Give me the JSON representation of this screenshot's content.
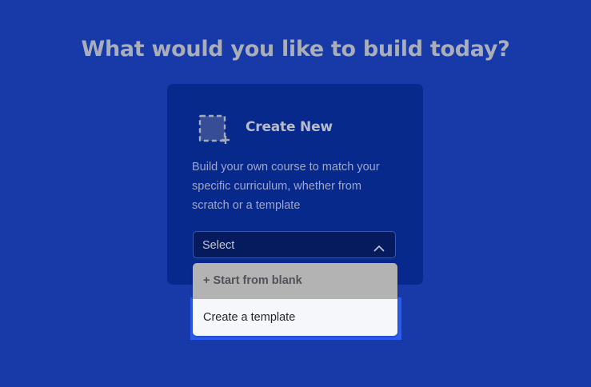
{
  "page": {
    "headline": "What would you like to build today?"
  },
  "card": {
    "icon": "dashed-square-plus-icon",
    "title": "Create New",
    "description": "Build your own course to match your specific curriculum, whether from scratch or a template"
  },
  "select": {
    "value": "Select",
    "state": "open",
    "chevron_icon": "chevron-up-icon",
    "options": [
      {
        "label": "+ Start from blank",
        "state": "hovered"
      },
      {
        "label": "Create a template",
        "state": "focused"
      }
    ]
  },
  "colors": {
    "background": "#183aa8",
    "card": "#08298c",
    "select_bg": "#061b5e",
    "option_hover": "#b3b3b3",
    "option_default": "#f6f7fa",
    "focus_ring": "#2a5cf0",
    "headline": "#a9aeb9"
  }
}
